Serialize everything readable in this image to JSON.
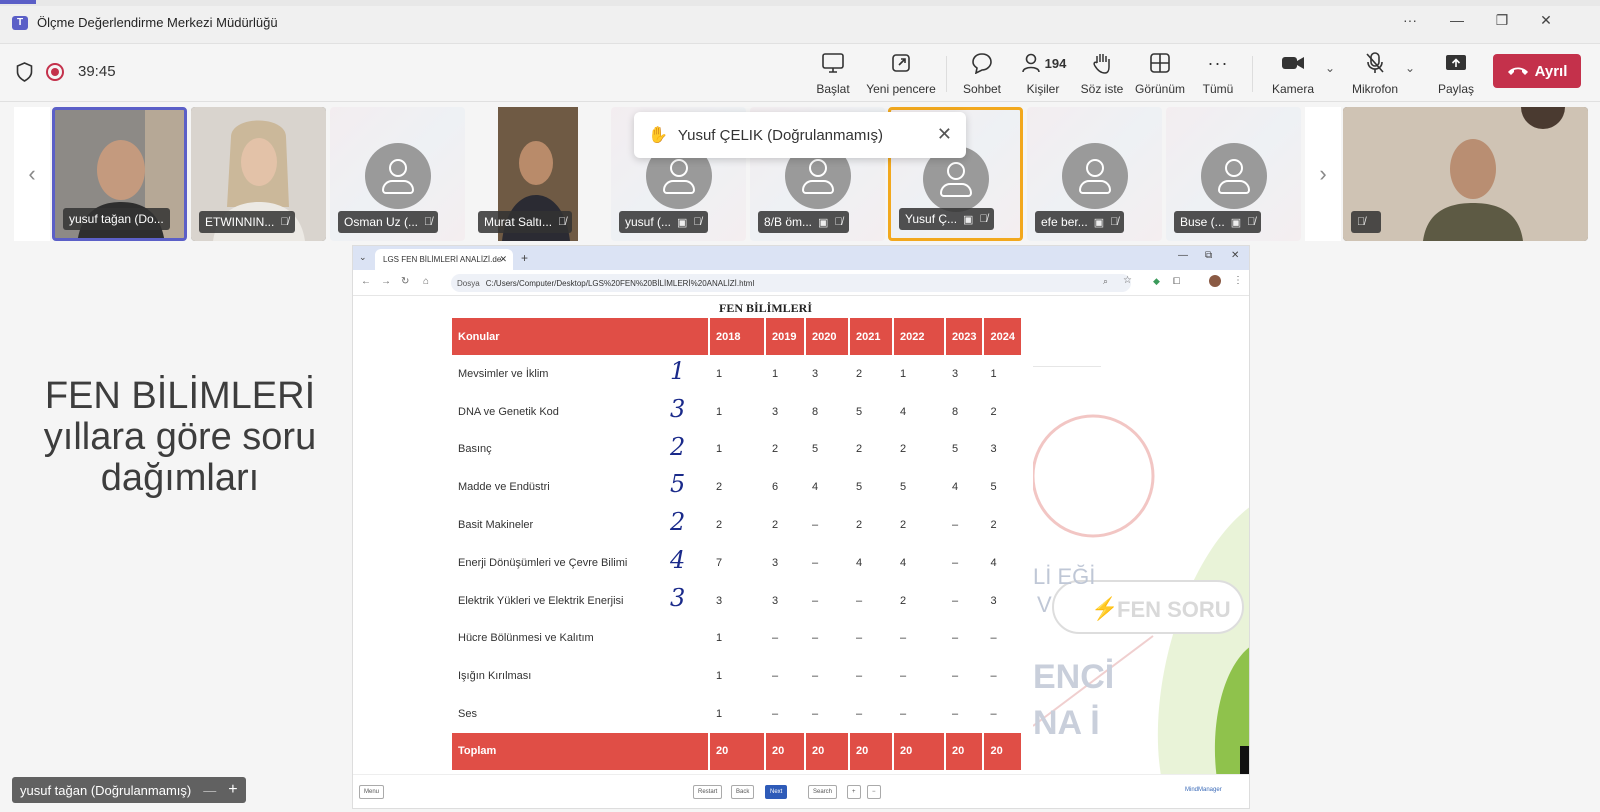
{
  "window": {
    "title": "Ölçme Değerlendirme Merkezi Müdürlüğü",
    "more": "···",
    "minimize": "—",
    "restore": "❐",
    "close": "✕"
  },
  "meeting": {
    "timer": "39:45"
  },
  "toolbar": {
    "start": "Başlat",
    "new_window": "Yeni pencere",
    "chat": "Sohbet",
    "people": "Kişiler",
    "people_count": "194",
    "raise": "Söz iste",
    "view": "Görünüm",
    "more": "Tümü",
    "camera": "Kamera",
    "mic": "Mikrofon",
    "share": "Paylaş",
    "leave": "Ayrıl"
  },
  "participants": [
    {
      "name": "yusuf tağan (Do..."
    },
    {
      "name": "ETWINNIN..."
    },
    {
      "name": "Osman Uz (..."
    },
    {
      "name": "Murat Saltı..."
    },
    {
      "name": "yusuf (..."
    },
    {
      "name": "8/B öm..."
    },
    {
      "name": "Yusuf Ç..."
    },
    {
      "name": "efe ber..."
    },
    {
      "name": "Buse (..."
    }
  ],
  "toast": {
    "text": "Yusuf ÇELIK (Doğrulanmamış)"
  },
  "left_caption": {
    "line1": "FEN BİLİMLERİ",
    "line2": "yıllara göre soru",
    "line3": "dağımları"
  },
  "browser": {
    "tab_title": "LGS FEN BİLİMLERİ ANALİZİ.de",
    "url_label": "Dosya",
    "url": "C:/Users/Computer/Desktop/LGS%20FEN%20BİLİMLERİ%20ANALİZİ.html"
  },
  "table": {
    "heading": "FEN BİLİMLERİ",
    "headers": [
      "Konular",
      "2018",
      "2019",
      "2020",
      "2021",
      "2022",
      "2023",
      "2024"
    ],
    "rows": [
      {
        "topic": "Mevsimler ve İklim",
        "hw": "1",
        "vals": [
          "1",
          "1",
          "3",
          "2",
          "1",
          "3",
          "1"
        ]
      },
      {
        "topic": "DNA ve Genetik Kod",
        "hw": "3",
        "vals": [
          "1",
          "3",
          "8",
          "5",
          "4",
          "8",
          "2"
        ]
      },
      {
        "topic": "Basınç",
        "hw": "2",
        "vals": [
          "1",
          "2",
          "5",
          "2",
          "2",
          "5",
          "3"
        ]
      },
      {
        "topic": "Madde ve Endüstri",
        "hw": "5",
        "vals": [
          "2",
          "6",
          "4",
          "5",
          "5",
          "4",
          "5"
        ]
      },
      {
        "topic": "Basit Makineler",
        "hw": "2",
        "vals": [
          "2",
          "2",
          "–",
          "2",
          "2",
          "–",
          "2"
        ]
      },
      {
        "topic": "Enerji Dönüşümleri ve Çevre Bilimi",
        "hw": "4",
        "vals": [
          "7",
          "3",
          "–",
          "4",
          "4",
          "–",
          "4"
        ]
      },
      {
        "topic": "Elektrik Yükleri ve Elektrik Enerjisi",
        "hw": "3",
        "vals": [
          "3",
          "3",
          "–",
          "–",
          "2",
          "–",
          "3"
        ]
      },
      {
        "topic": "Hücre Bölünmesi ve Kalıtım",
        "hw": "",
        "vals": [
          "1",
          "–",
          "–",
          "–",
          "–",
          "–",
          "–"
        ]
      },
      {
        "topic": "Işığın Kırılması",
        "hw": "",
        "vals": [
          "1",
          "–",
          "–",
          "–",
          "–",
          "–",
          "–"
        ]
      },
      {
        "topic": "Ses",
        "hw": "",
        "vals": [
          "1",
          "–",
          "–",
          "–",
          "–",
          "–",
          "–"
        ]
      }
    ],
    "total": {
      "label": "Toplam",
      "vals": [
        "20",
        "20",
        "20",
        "20",
        "20",
        "20",
        "20"
      ]
    }
  },
  "bg_text": {
    "a": "Lİ EĞİ",
    "b": "V",
    "c": "ENCİ",
    "d": "NA İ",
    "fen_soru": "FEN SORU"
  },
  "pagebar": {
    "menu": "Menu",
    "restart": "Restart",
    "back": "Back",
    "next": "Next",
    "search": "Search",
    "plus": "+",
    "minus": "−",
    "brand": "MindManager"
  },
  "speaker": {
    "name": "yusuf tağan (Doğrulanmamış)",
    "minus": "—",
    "plus": "+"
  },
  "colors": {
    "accent": "#5b5fc7",
    "leave": "#c4314b",
    "table_red": "#e04e46",
    "speaking": "#f2a81d"
  }
}
